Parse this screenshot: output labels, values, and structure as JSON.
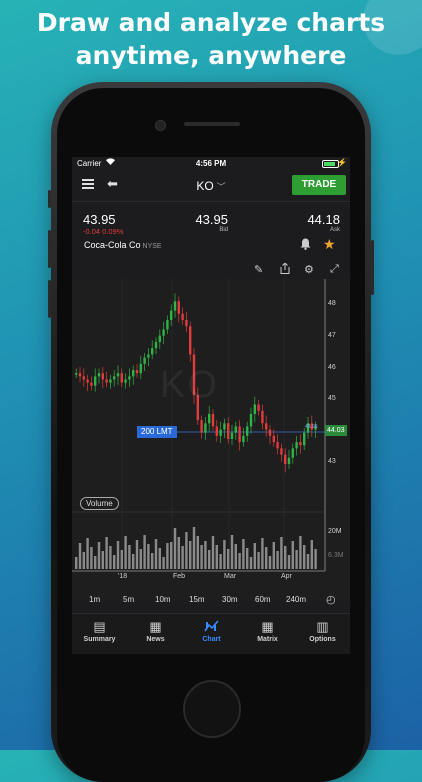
{
  "headline": {
    "line1": "Draw and analyze charts",
    "line2": "anytime, anywhere"
  },
  "status_bar": {
    "carrier": "Carrier",
    "time": "4:56 PM"
  },
  "nav": {
    "ticker": "KO",
    "trade_label": "TRADE"
  },
  "quote": {
    "last": "43.95",
    "change": "-0.04  0.09%",
    "bid": "43.95",
    "bid_label": "Bid",
    "ask": "44.18",
    "ask_label": "Ask",
    "name": "Coca-Cola Co",
    "exchange": "NYSE"
  },
  "chart": {
    "watermark": "KO",
    "order_label": "200 LMT",
    "last_price_tag": "44.03",
    "small_tag": "43.95",
    "volume_label": "Volume",
    "y_ticks": [
      "48",
      "47",
      "46",
      "45",
      "44",
      "43"
    ],
    "vol_ticks": [
      "20M",
      "6.3M"
    ],
    "x_ticks": [
      "'18",
      "Feb",
      "Mar",
      "Apr"
    ]
  },
  "intervals": [
    "1m",
    "5m",
    "10m",
    "15m",
    "30m",
    "60m",
    "240m"
  ],
  "tabs": [
    {
      "label": "Summary",
      "icon": "summary-icon"
    },
    {
      "label": "News",
      "icon": "news-icon"
    },
    {
      "label": "Chart",
      "icon": "chart-icon",
      "active": true
    },
    {
      "label": "Matrix",
      "icon": "matrix-icon"
    },
    {
      "label": "Options",
      "icon": "options-icon"
    }
  ],
  "colors": {
    "up": "#2fb344",
    "down": "#e23b3b",
    "trade": "#2e9e33",
    "active_tab": "#3a8bff",
    "star": "#f0a531"
  }
}
